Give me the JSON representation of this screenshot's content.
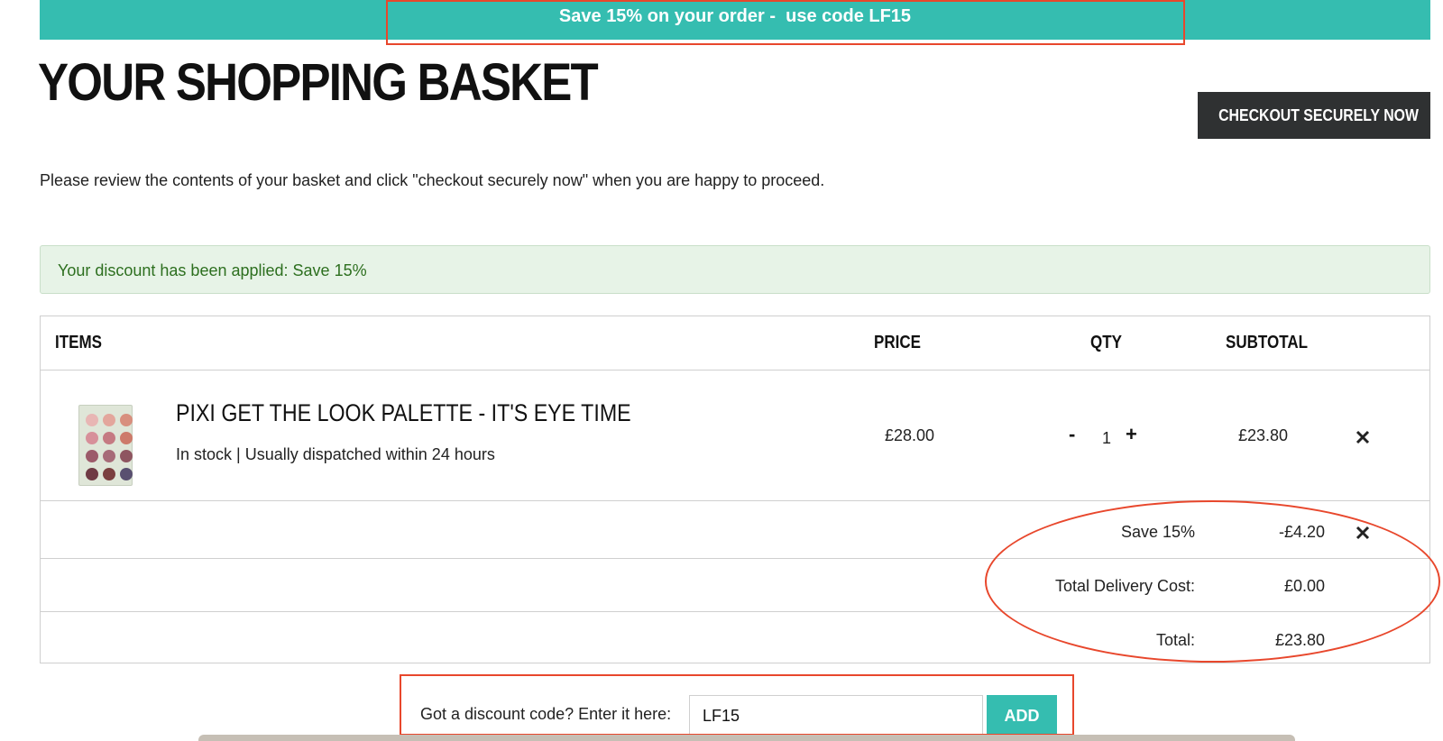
{
  "promo": {
    "text": "Save 15% on your order -  use code LF15"
  },
  "header": {
    "title": "YOUR SHOPPING BASKET",
    "checkout_label": "CHECKOUT SECURELY NOW"
  },
  "intro": "Please review the contents of your basket and click \"checkout securely now\" when you are happy to proceed.",
  "alert": {
    "message": "Your discount has been applied: Save 15%"
  },
  "table": {
    "headers": {
      "items": "ITEMS",
      "price": "PRICE",
      "qty": "QTY",
      "subtotal": "SUBTOTAL"
    },
    "item": {
      "name": "PIXI GET THE LOOK PALETTE - IT'S EYE TIME",
      "stock": "In stock | Usually dispatched within 24 hours",
      "price": "£28.00",
      "qty": "1",
      "qty_minus": "-",
      "qty_plus": "+",
      "subtotal": "£23.80",
      "palette_colors": [
        "#e8b6b4",
        "#e3a69c",
        "#d88f7e",
        "#d7909a",
        "#c57a82",
        "#cd7a6a",
        "#9c5a6a",
        "#a76b78",
        "#8e5560",
        "#6f3a44",
        "#7b3f3f",
        "#595070"
      ]
    },
    "summary": [
      {
        "label": "Save 15%",
        "value": "-£4.20",
        "removable": true
      },
      {
        "label": "Total Delivery Cost:",
        "value": "£0.00",
        "removable": false
      },
      {
        "label": "Total:",
        "value": "£23.80",
        "removable": false
      }
    ]
  },
  "discount": {
    "label": "Got a discount code? Enter it here:",
    "value": "LF15",
    "add_label": "ADD"
  },
  "colors": {
    "accent": "#35bdb0",
    "dark_button": "#2f3132",
    "alert_bg": "#e7f3e7",
    "alert_text": "#2d6f1f",
    "annotation": "#e8472c"
  },
  "icons": {
    "checkout": "lock-icon",
    "remove": "close-icon"
  }
}
